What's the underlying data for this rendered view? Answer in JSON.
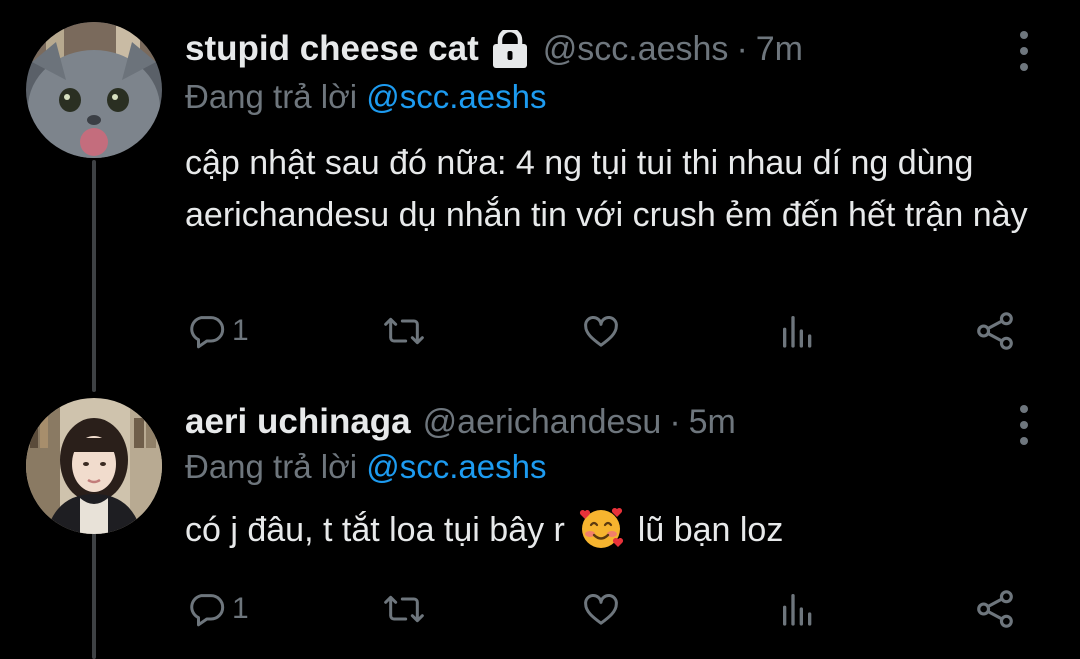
{
  "tweets": [
    {
      "display_name": "stupid cheese cat",
      "protected_icon": "lock-icon",
      "handle": "@scc.aeshs",
      "separator": "·",
      "time": "7m",
      "replying_prefix": "Đang trả lời",
      "replying_to": "@scc.aeshs",
      "body": "cập nhật sau đó nữa: 4 ng tụi tui thi nhau dí ng dùng aerichandesu dụ nhắn tin với crush ẻm đến hết trận này",
      "reply_count": "1"
    },
    {
      "display_name": "aeri uchinaga",
      "handle": "@aerichandesu",
      "separator": "·",
      "time": "5m",
      "replying_prefix": "Đang trả lời",
      "replying_to": "@scc.aeshs",
      "body_before_emoji": "có j đâu, t tắt loa tụi bây r",
      "emoji": "smiling-face-with-hearts",
      "body_after_emoji": "lũ bạn loz",
      "reply_count": "1"
    }
  ],
  "colors": {
    "background": "#000000",
    "primary_text": "#e7e9ea",
    "secondary_text": "#6e767d",
    "link": "#1d9bf0",
    "thread_line": "#3e4144"
  },
  "icons": [
    "reply-icon",
    "retweet-icon",
    "like-icon",
    "analytics-icon",
    "share-icon",
    "more-options-icon"
  ]
}
